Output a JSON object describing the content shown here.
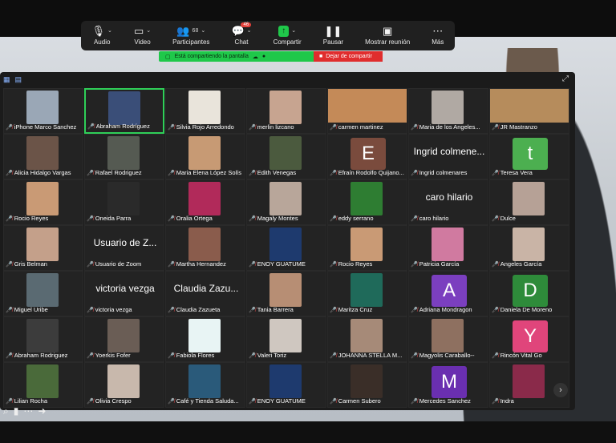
{
  "toolbar": {
    "audio": "Audio",
    "video": "Video",
    "participants": "Participantes",
    "participants_count": "68",
    "chat": "Chat",
    "chat_badge": "46",
    "share": "Compartir",
    "pause": "Pausar",
    "show_meeting": "Mostrar reunión",
    "more": "Más"
  },
  "share_bar": {
    "status": "Está compartiendo la pantalla",
    "stop": "Dejar de compartir"
  },
  "participants": [
    {
      "name": "iPhone Marco Sanchez",
      "kind": "photo",
      "color": "#9aa7b6"
    },
    {
      "name": "Abraham Rodríguez",
      "kind": "photo",
      "color": "#3a4e78",
      "active": true
    },
    {
      "name": "Silvia Rojo Arredondo",
      "kind": "photo",
      "color": "#e9e4db"
    },
    {
      "name": "merlin lizcano",
      "kind": "photo",
      "color": "#c7a490"
    },
    {
      "name": "carmen martinez",
      "kind": "wide",
      "color": "#c48a58"
    },
    {
      "name": "Maria de los Angeles...",
      "kind": "photo",
      "color": "#b0a9a3"
    },
    {
      "name": "JR Mastranzo",
      "kind": "wide",
      "color": "#b68c5c"
    },
    {
      "name": "Alicia Hidalgo Vargas",
      "kind": "photo",
      "color": "#6b5448"
    },
    {
      "name": "Rafael Rodriguez",
      "kind": "photo",
      "color": "#555a52"
    },
    {
      "name": "Maria Elena López Solís",
      "kind": "photo",
      "color": "#c79a74"
    },
    {
      "name": "Edith Venegas",
      "kind": "photo",
      "color": "#4b5a3e"
    },
    {
      "name": "Efraín Rodolfo Quijano...",
      "kind": "initial",
      "initial": "E",
      "color": "#7a4b3d"
    },
    {
      "name": "Ingrid colmenares",
      "kind": "bigname",
      "big": "Ingrid colmene..."
    },
    {
      "name": "Teresa Vera",
      "kind": "initial",
      "initial": "t",
      "color": "#4caf50"
    },
    {
      "name": "Rocio Reyes",
      "kind": "photo",
      "color": "#c99a75"
    },
    {
      "name": "Oneida Parra",
      "kind": "photo",
      "color": "#2a2a2a"
    },
    {
      "name": "Oralia Ortega",
      "kind": "photo",
      "color": "#b12a5a"
    },
    {
      "name": "Magaly Montes",
      "kind": "photo",
      "color": "#b8a69a"
    },
    {
      "name": "eddy serrano",
      "kind": "photo",
      "color": "#2e7d32"
    },
    {
      "name": "caro hilario",
      "kind": "bigname",
      "big": "caro hilario"
    },
    {
      "name": "Dulce",
      "kind": "photo",
      "color": "#b6a196"
    },
    {
      "name": "Gris Belman",
      "kind": "photo",
      "color": "#c4a08a"
    },
    {
      "name": "Usuario de Zoom",
      "kind": "bigname",
      "big": "Usuario de Z..."
    },
    {
      "name": "Martha Hernandez",
      "kind": "photo",
      "color": "#8a5c4c"
    },
    {
      "name": "ENOY GUATUME",
      "kind": "photo",
      "color": "#1e3a6e"
    },
    {
      "name": "Rocio Reyes",
      "kind": "photo",
      "color": "#c99a75"
    },
    {
      "name": "Patricia García",
      "kind": "photo",
      "color": "#d07aa0"
    },
    {
      "name": "Angeles García",
      "kind": "photo",
      "color": "#c9b4a6"
    },
    {
      "name": "Miguel Uribe",
      "kind": "photo",
      "color": "#5a6a72"
    },
    {
      "name": "victoria vezga",
      "kind": "bigname",
      "big": "victoria vezga"
    },
    {
      "name": "Claudia Zazueta",
      "kind": "bigname",
      "big": "Claudia Zazu..."
    },
    {
      "name": "Tania Barrera",
      "kind": "photo",
      "color": "#b78e74"
    },
    {
      "name": "Maritza Cruz",
      "kind": "photo",
      "color": "#1f6a5a"
    },
    {
      "name": "Adriana Mondragon",
      "kind": "initial",
      "initial": "A",
      "color": "#7b3fbf"
    },
    {
      "name": "Daniela De Moreno",
      "kind": "initial",
      "initial": "D",
      "color": "#2e8b3a"
    },
    {
      "name": "Abraham Rodriguez",
      "kind": "photo",
      "color": "#3c3c3c"
    },
    {
      "name": "Yoerkis Fofer",
      "kind": "photo",
      "color": "#6a5d55"
    },
    {
      "name": "Fabiola Flores",
      "kind": "photo",
      "color": "#e8f4f4"
    },
    {
      "name": "Valeri Toriz",
      "kind": "photo",
      "color": "#cfc7c0"
    },
    {
      "name": "JOHANNA STELLA M...",
      "kind": "photo",
      "color": "#a68a78"
    },
    {
      "name": "Magyolis Caraballo--",
      "kind": "photo",
      "color": "#8e7060"
    },
    {
      "name": "Rincón Vital Go",
      "kind": "initial",
      "initial": "Y",
      "color": "#e0457b"
    },
    {
      "name": "Lilian Rocha",
      "kind": "photo",
      "color": "#4a6a3a"
    },
    {
      "name": "Olivia Crespo",
      "kind": "photo",
      "color": "#c8b8ac"
    },
    {
      "name": "Café y Tienda Saluda...",
      "kind": "photo",
      "color": "#2a5a7a"
    },
    {
      "name": "ENOY GUATUME",
      "kind": "photo",
      "color": "#1e3a6e"
    },
    {
      "name": "Carmen Subero",
      "kind": "photo",
      "color": "#3a2e28"
    },
    {
      "name": "Mercedes Sanchez",
      "kind": "initial",
      "initial": "M",
      "color": "#6a2fb0"
    },
    {
      "name": "Indra",
      "kind": "photo",
      "color": "#8a2a4a"
    }
  ]
}
